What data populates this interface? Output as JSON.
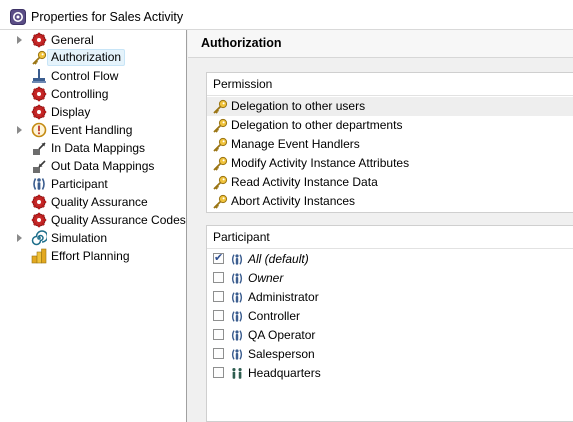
{
  "window": {
    "title": "Properties for Sales Activity"
  },
  "tree": {
    "items": [
      {
        "label": "General",
        "expandable": true,
        "icon": "red-gear-icon"
      },
      {
        "label": "Authorization",
        "expandable": false,
        "icon": "key-icon",
        "selected": true
      },
      {
        "label": "Control Flow",
        "expandable": false,
        "icon": "control-flow-icon"
      },
      {
        "label": "Controlling",
        "expandable": false,
        "icon": "red-gear-icon"
      },
      {
        "label": "Display",
        "expandable": false,
        "icon": "red-gear-icon"
      },
      {
        "label": "Event Handling",
        "expandable": true,
        "icon": "event-warning-icon"
      },
      {
        "label": "In Data Mappings",
        "expandable": false,
        "icon": "in-data-mapping-icon"
      },
      {
        "label": "Out Data Mappings",
        "expandable": false,
        "icon": "out-data-mapping-icon"
      },
      {
        "label": "Participant",
        "expandable": false,
        "icon": "participant-icon"
      },
      {
        "label": "Quality Assurance",
        "expandable": false,
        "icon": "red-gear-icon"
      },
      {
        "label": "Quality Assurance Codes",
        "expandable": false,
        "icon": "red-gear-icon"
      },
      {
        "label": "Simulation",
        "expandable": true,
        "icon": "simulation-spiral-icon"
      },
      {
        "label": "Effort Planning",
        "expandable": false,
        "icon": "effort-planning-icon"
      }
    ]
  },
  "content": {
    "title": "Authorization",
    "permission": {
      "header": "Permission",
      "items": [
        "Delegation to other users",
        "Delegation to other departments",
        "Manage Event Handlers",
        "Modify Activity Instance Attributes",
        "Read Activity Instance Data",
        "Abort Activity Instances"
      ]
    },
    "participant": {
      "header": "Participant",
      "items": [
        {
          "label": "All (default)",
          "checked": true,
          "italic": true,
          "icon": "participant-icon"
        },
        {
          "label": "Owner",
          "checked": false,
          "italic": true,
          "icon": "participant-icon"
        },
        {
          "label": "Administrator",
          "checked": false,
          "italic": false,
          "icon": "participant-icon"
        },
        {
          "label": "Controller",
          "checked": false,
          "italic": false,
          "icon": "participant-icon"
        },
        {
          "label": "QA Operator",
          "checked": false,
          "italic": false,
          "icon": "participant-icon"
        },
        {
          "label": "Salesperson",
          "checked": false,
          "italic": false,
          "icon": "participant-icon"
        },
        {
          "label": "Headquarters",
          "checked": false,
          "italic": false,
          "icon": "organization-icon"
        }
      ]
    }
  }
}
